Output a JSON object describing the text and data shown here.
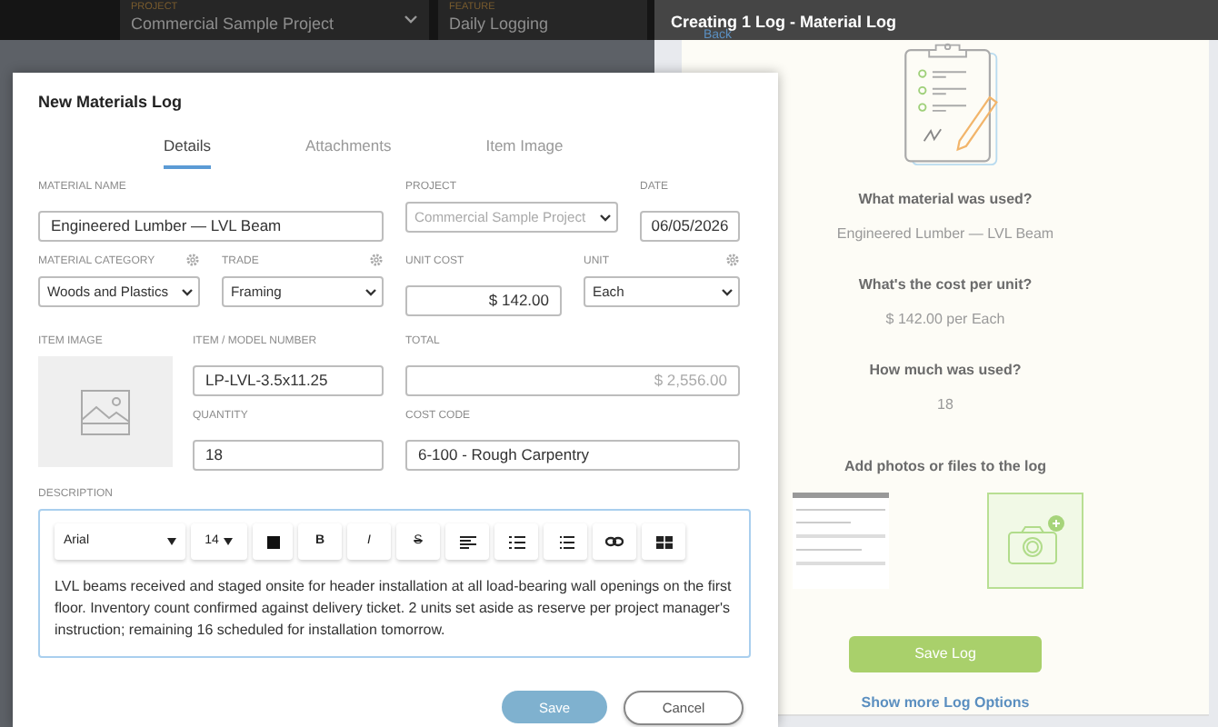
{
  "top_bar": {
    "project": {
      "label": "PROJECT",
      "value": "Commercial Sample Project"
    },
    "feature": {
      "label": "FEATURE",
      "value": "Daily Logging"
    }
  },
  "side_panel": {
    "title": "Creating 1 Log - Material Log",
    "back": "Back",
    "summary": [
      {
        "question": "What material was used?",
        "answer": "Engineered Lumber — LVL Beam"
      },
      {
        "question": "What's the cost per unit?",
        "answer": "$ 142.00 per Each"
      },
      {
        "question": "How much was used?",
        "answer": "18"
      }
    ],
    "attach_heading": "Add photos or files to the log",
    "save_button": "Save Log",
    "more_link": "Show more Log Options"
  },
  "modal": {
    "title": "New Materials Log",
    "tabs": [
      {
        "label": "Details",
        "selected": true
      },
      {
        "label": "Attachments",
        "selected": false
      },
      {
        "label": "Item Image",
        "selected": false
      }
    ],
    "material_name": {
      "label": "MATERIAL NAME",
      "value": "Engineered Lumber — LVL Beam"
    },
    "project": {
      "label": "PROJECT",
      "value": "Commercial Sample Project",
      "disabled": true
    },
    "date": {
      "label": "DATE",
      "value": "06/05/2026"
    },
    "material_category": {
      "label": "MATERIAL CATEGORY",
      "value": "Woods and Plastics",
      "settings": true
    },
    "trade": {
      "label": "TRADE",
      "value": "Framing",
      "settings": true
    },
    "unit_cost": {
      "label": "UNIT COST",
      "value": "$ 142.00"
    },
    "unit": {
      "label": "UNIT",
      "value": "Each",
      "settings": true
    },
    "item_image": {
      "label": "ITEM IMAGE"
    },
    "item_model_number": {
      "label": "ITEM / MODEL NUMBER",
      "value": "LP-LVL-3.5x11.25"
    },
    "total": {
      "label": "TOTAL",
      "value": "$ 2,556.00",
      "disabled": true
    },
    "quantity": {
      "label": "QUANTITY",
      "value": "18"
    },
    "cost_code": {
      "label": "COST CODE",
      "value": "6-100 - Rough Carpentry"
    },
    "description": {
      "label": "DESCRIPTION",
      "font": "Arial",
      "size": "14",
      "tools": [
        {
          "kind": "color"
        },
        {
          "kind": "bold",
          "text": "B"
        },
        {
          "kind": "italic",
          "text": "I"
        },
        {
          "kind": "strike",
          "text": "S"
        },
        {
          "kind": "align"
        },
        {
          "kind": "bullets"
        },
        {
          "kind": "numbered"
        },
        {
          "kind": "link"
        },
        {
          "kind": "table"
        }
      ],
      "text": "LVL beams received and staged onsite for header installation at all load-bearing wall openings on the first floor. Inventory count confirmed against delivery ticket. 2 units set aside as reserve per project manager's instruction; remaining 16 scheduled for installation tomorrow."
    },
    "buttons": [
      {
        "label": "Save",
        "kind": "primary"
      },
      {
        "label": "Cancel",
        "kind": "secondary"
      }
    ]
  }
}
